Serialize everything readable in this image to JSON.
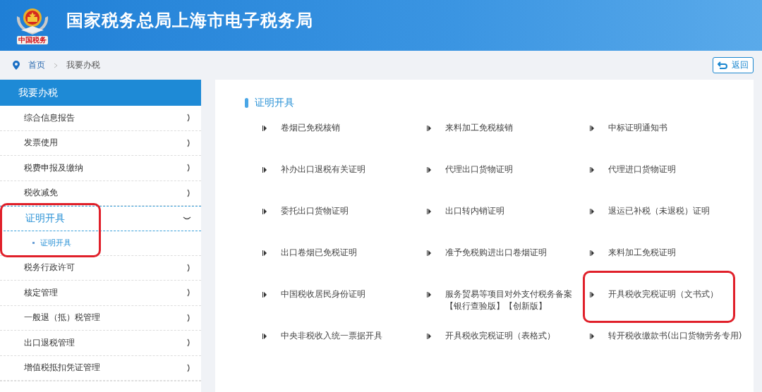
{
  "header": {
    "logo_caption": "中国税务",
    "title": "国家税务总局上海市电子税务局"
  },
  "breadcrumb": [
    {
      "label": "首页",
      "kind": "link"
    },
    {
      "label": "我要办税",
      "kind": "current"
    }
  ],
  "back_button": {
    "label": "返回"
  },
  "sidebar": {
    "title": "我要办税",
    "items": [
      {
        "label": "综合信息报告",
        "expanded": false,
        "highlighted": false
      },
      {
        "label": "发票使用",
        "expanded": false,
        "highlighted": false
      },
      {
        "label": "税费申报及缴纳",
        "expanded": false,
        "highlighted": false
      },
      {
        "label": "税收减免",
        "expanded": false,
        "highlighted": false
      },
      {
        "label": "证明开具",
        "expanded": true,
        "highlighted": true,
        "children": [
          {
            "label": "证明开具",
            "selected": true
          }
        ]
      },
      {
        "label": "税务行政许可",
        "expanded": false,
        "highlighted": false
      },
      {
        "label": "核定管理",
        "expanded": false,
        "highlighted": false
      },
      {
        "label": "一般退（抵）税管理",
        "expanded": false,
        "highlighted": false
      },
      {
        "label": "出口退税管理",
        "expanded": false,
        "highlighted": false
      },
      {
        "label": "增值税抵扣凭证管理",
        "expanded": false,
        "highlighted": false
      }
    ]
  },
  "content": {
    "section_title": "证明开具",
    "items": [
      {
        "label": "卷烟已免税核销",
        "highlighted": false
      },
      {
        "label": "来料加工免税核销",
        "highlighted": false
      },
      {
        "label": "中标证明通知书",
        "highlighted": false
      },
      {
        "label": "补办出口退税有关证明",
        "highlighted": false
      },
      {
        "label": "代理出口货物证明",
        "highlighted": false
      },
      {
        "label": "代理进口货物证明",
        "highlighted": false
      },
      {
        "label": "委托出口货物证明",
        "highlighted": false
      },
      {
        "label": "出口转内销证明",
        "highlighted": false
      },
      {
        "label": "退运已补税（未退税）证明",
        "highlighted": false
      },
      {
        "label": "出口卷烟已免税证明",
        "highlighted": false
      },
      {
        "label": "准予免税购进出口卷烟证明",
        "highlighted": false
      },
      {
        "label": "来料加工免税证明",
        "highlighted": false
      },
      {
        "label": "中国税收居民身份证明",
        "highlighted": false
      },
      {
        "label": "服务贸易等项目对外支付税务备案【银行查验版】【创新版】",
        "highlighted": false
      },
      {
        "label": "开具税收完税证明（文书式）",
        "highlighted": true
      },
      {
        "label": "中央非税收入统一票据开具",
        "highlighted": false
      },
      {
        "label": "开具税收完税证明（表格式）",
        "highlighted": false
      },
      {
        "label": "转开税收缴款书(出口货物劳务专用)",
        "highlighted": false
      }
    ]
  }
}
